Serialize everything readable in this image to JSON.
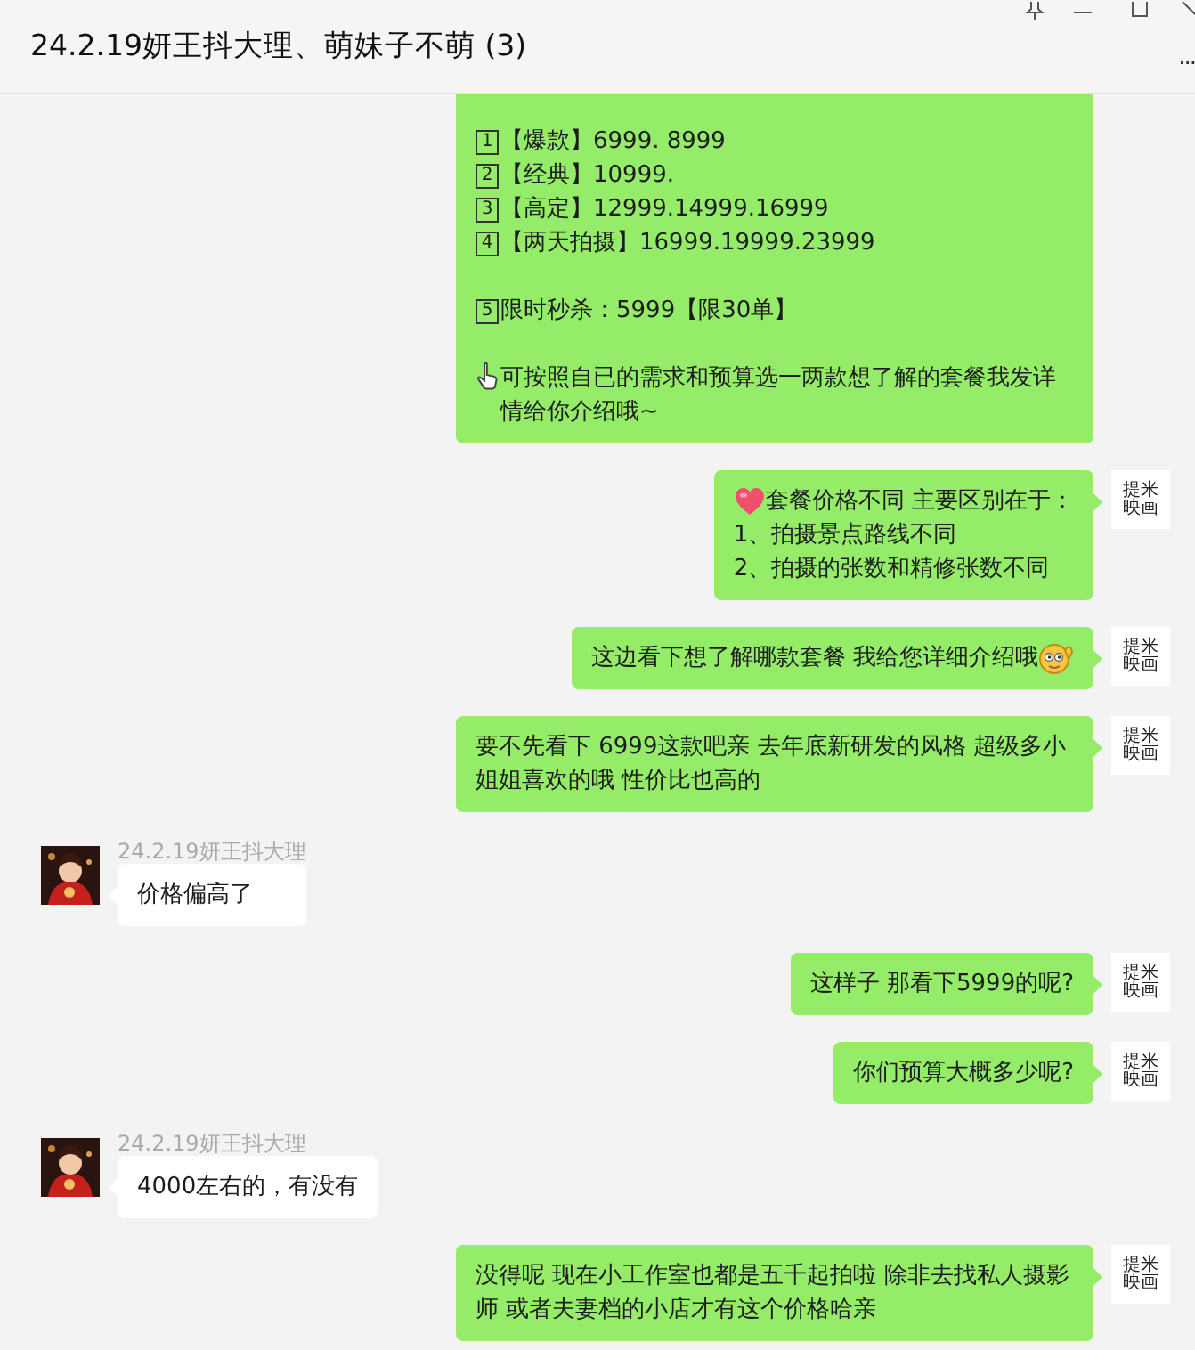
{
  "window": {
    "title": "24.2.19妍王抖大理、萌妹子不萌 (3)",
    "more": "..."
  },
  "messages": [
    {
      "kind": "sent",
      "cut_top": true,
      "paragraphs": [
        [
          {
            "kind": "numbered",
            "badge": "1",
            "text": "【爆款】6999. 8999"
          },
          {
            "kind": "numbered",
            "badge": "2",
            "text": "【经典】10999."
          },
          {
            "kind": "numbered",
            "badge": "3",
            "text": "【高定】12999.14999.16999"
          },
          {
            "kind": "numbered",
            "badge": "4",
            "text": "【两天拍摄】16999.19999.23999"
          }
        ],
        [
          {
            "kind": "numbered",
            "badge": "5",
            "text": "限时秒杀：5999【限30单】"
          }
        ],
        [
          {
            "kind": "pointer",
            "text": "可按照自已的需求和预算选一两款想了解的套餐我发详情给你介绍哦~"
          }
        ]
      ]
    },
    {
      "kind": "sent",
      "avatar_text": "提米映画",
      "paragraphs": [
        [
          {
            "kind": "heart",
            "text": "套餐价格不同 主要区别在于："
          },
          {
            "kind": "plain",
            "text": "1、拍摄景点路线不同"
          },
          {
            "kind": "plain",
            "text": "2、拍摄的张数和精修张数不同"
          }
        ]
      ]
    },
    {
      "kind": "sent",
      "avatar_text": "提米映画",
      "paragraphs": [
        [
          {
            "kind": "smiley",
            "text": "这边看下想了解哪款套餐  我给您详细介绍哦"
          }
        ]
      ]
    },
    {
      "kind": "sent",
      "avatar_text": "提米映画",
      "paragraphs": [
        [
          {
            "kind": "plain",
            "text": "要不先看下 6999这款吧亲  去年底新研发的风格  超级多小姐姐喜欢的哦   性价比也高的"
          }
        ]
      ]
    },
    {
      "kind": "received",
      "sender": "24.2.19妍王抖大理",
      "paragraphs": [
        [
          {
            "kind": "plain",
            "text": "价格偏高了"
          }
        ]
      ]
    },
    {
      "kind": "sent",
      "avatar_text": "提米映画",
      "paragraphs": [
        [
          {
            "kind": "plain",
            "text": "这样子   那看下5999的呢?"
          }
        ]
      ]
    },
    {
      "kind": "sent",
      "avatar_text": "提米映画",
      "paragraphs": [
        [
          {
            "kind": "plain",
            "text": "你们预算大概多少呢?"
          }
        ]
      ]
    },
    {
      "kind": "received",
      "sender": "24.2.19妍王抖大理",
      "paragraphs": [
        [
          {
            "kind": "plain",
            "text": "4000左右的，有没有"
          }
        ]
      ]
    },
    {
      "kind": "sent",
      "avatar_text": "提米映画",
      "paragraphs": [
        [
          {
            "kind": "plain",
            "text": "没得呢    现在小工作室也都是五千起拍啦    除非去找私人摄影师 或者夫妻档的小店才有这个价格哈亲"
          }
        ]
      ]
    }
  ]
}
